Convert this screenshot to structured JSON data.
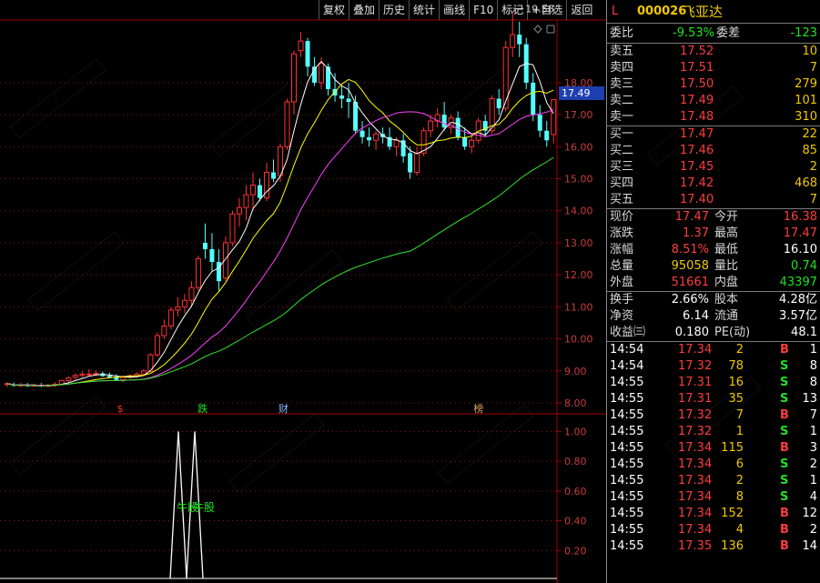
{
  "toolbar": [
    "复权",
    "叠加",
    "历史",
    "统计",
    "画线",
    "F10",
    "标记",
    "+自选",
    "返回"
  ],
  "stock": {
    "flag": "L",
    "code": "000026",
    "name": "飞亚达"
  },
  "commission": {
    "ratio_label": "委比",
    "ratio": "-9.53%",
    "diff_label": "委差",
    "diff": "-123"
  },
  "asks": [
    {
      "label": "卖五",
      "price": "17.52",
      "vol": "10"
    },
    {
      "label": "卖四",
      "price": "17.51",
      "vol": "7"
    },
    {
      "label": "卖三",
      "price": "17.50",
      "vol": "279"
    },
    {
      "label": "卖二",
      "price": "17.49",
      "vol": "101"
    },
    {
      "label": "卖一",
      "price": "17.48",
      "vol": "310"
    }
  ],
  "bids": [
    {
      "label": "买一",
      "price": "17.47",
      "vol": "22"
    },
    {
      "label": "买二",
      "price": "17.46",
      "vol": "85"
    },
    {
      "label": "买三",
      "price": "17.45",
      "vol": "2"
    },
    {
      "label": "买四",
      "price": "17.42",
      "vol": "468"
    },
    {
      "label": "买五",
      "price": "17.40",
      "vol": "7"
    }
  ],
  "stats1": [
    {
      "l1": "现价",
      "v1": "17.47",
      "c1": "red",
      "l2": "今开",
      "v2": "16.38",
      "c2": "red"
    },
    {
      "l1": "涨跌",
      "v1": "1.37",
      "c1": "red",
      "l2": "最高",
      "v2": "17.47",
      "c2": "red"
    },
    {
      "l1": "涨幅",
      "v1": "8.51%",
      "c1": "red",
      "l2": "最低",
      "v2": "16.10",
      "c2": "white"
    },
    {
      "l1": "总量",
      "v1": "95058",
      "c1": "yellow",
      "l2": "量比",
      "v2": "0.74",
      "c2": "green"
    },
    {
      "l1": "外盘",
      "v1": "51661",
      "c1": "red",
      "l2": "内盘",
      "v2": "43397",
      "c2": "green"
    }
  ],
  "stats2": [
    {
      "l1": "换手",
      "v1": "2.66%",
      "l2": "股本",
      "v2": "4.28亿"
    },
    {
      "l1": "净资",
      "v1": "6.14",
      "l2": "流通",
      "v2": "3.57亿"
    },
    {
      "l1": "收益㈢",
      "v1": "0.180",
      "l2": "PE(动)",
      "v2": "48.1"
    }
  ],
  "trades": [
    {
      "time": "14:54",
      "price": "17.34",
      "vol": "2",
      "side": "B",
      "n": "1"
    },
    {
      "time": "14:54",
      "price": "17.32",
      "vol": "78",
      "side": "S",
      "n": "8"
    },
    {
      "time": "14:55",
      "price": "17.31",
      "vol": "16",
      "side": "S",
      "n": "8"
    },
    {
      "time": "14:55",
      "price": "17.31",
      "vol": "35",
      "side": "S",
      "n": "13"
    },
    {
      "time": "14:55",
      "price": "17.32",
      "vol": "7",
      "side": "B",
      "n": "7"
    },
    {
      "time": "14:55",
      "price": "17.32",
      "vol": "1",
      "side": "S",
      "n": "1"
    },
    {
      "time": "14:55",
      "price": "17.34",
      "vol": "115",
      "side": "B",
      "n": "3"
    },
    {
      "time": "14:55",
      "price": "17.34",
      "vol": "6",
      "side": "S",
      "n": "2"
    },
    {
      "time": "14:55",
      "price": "17.34",
      "vol": "2",
      "side": "S",
      "n": "1"
    },
    {
      "time": "14:55",
      "price": "17.34",
      "vol": "8",
      "side": "S",
      "n": "4"
    },
    {
      "time": "14:55",
      "price": "17.34",
      "vol": "152",
      "side": "B",
      "n": "12"
    },
    {
      "time": "14:55",
      "price": "17.34",
      "vol": "4",
      "side": "B",
      "n": "2"
    },
    {
      "time": "14:55",
      "price": "17.35",
      "vol": "136",
      "side": "B",
      "n": "14"
    }
  ],
  "chart": {
    "current_price": "17.49",
    "high_label": "19.58",
    "price_axis": [
      "18.00",
      "17.00",
      "16.00",
      "15.00",
      "14.00",
      "13.00",
      "12.00",
      "11.00",
      "10.00",
      "9.00",
      "8.00"
    ],
    "markers": [
      {
        "text": "$",
        "color": "#ff3030"
      },
      {
        "text": "跌",
        "color": "#21e021"
      },
      {
        "text": "财",
        "color": "#8fb8ff"
      },
      {
        "text": "榜",
        "color": "#e0a060"
      }
    ],
    "indicator_axis": [
      "1.00",
      "0.80",
      "0.60",
      "0.40",
      "0.20"
    ],
    "indicator_label": "牛股",
    "indicator_label2": "牛股",
    "colors": {
      "up": "#ff3232",
      "down": "#54ffff",
      "ma5": "#ffffff",
      "ma10": "#ffff00",
      "ma20": "#ff40ff",
      "ma60": "#2ee62e"
    }
  },
  "chart_data": {
    "type": "candlestick",
    "ylim": [
      7.8,
      19.9
    ],
    "candles": [
      {
        "o": 8.58,
        "h": 8.64,
        "l": 8.5,
        "c": 8.6
      },
      {
        "o": 8.58,
        "h": 8.64,
        "l": 8.5,
        "c": 8.54
      },
      {
        "o": 8.55,
        "h": 8.62,
        "l": 8.5,
        "c": 8.56
      },
      {
        "o": 8.55,
        "h": 8.62,
        "l": 8.5,
        "c": 8.53
      },
      {
        "o": 8.54,
        "h": 8.6,
        "l": 8.5,
        "c": 8.55
      },
      {
        "o": 8.55,
        "h": 8.62,
        "l": 8.5,
        "c": 8.52
      },
      {
        "o": 8.53,
        "h": 8.6,
        "l": 8.48,
        "c": 8.55
      },
      {
        "o": 8.55,
        "h": 8.65,
        "l": 8.5,
        "c": 8.58
      },
      {
        "o": 8.58,
        "h": 8.72,
        "l": 8.55,
        "c": 8.7
      },
      {
        "o": 8.7,
        "h": 8.82,
        "l": 8.65,
        "c": 8.78
      },
      {
        "o": 8.8,
        "h": 8.92,
        "l": 8.72,
        "c": 8.86
      },
      {
        "o": 8.86,
        "h": 8.98,
        "l": 8.8,
        "c": 8.9
      },
      {
        "o": 8.88,
        "h": 9.05,
        "l": 8.82,
        "c": 8.9
      },
      {
        "o": 8.9,
        "h": 9.02,
        "l": 8.85,
        "c": 8.92
      },
      {
        "o": 8.92,
        "h": 8.98,
        "l": 8.8,
        "c": 8.84
      },
      {
        "o": 8.85,
        "h": 8.95,
        "l": 8.78,
        "c": 8.8
      },
      {
        "o": 8.8,
        "h": 8.9,
        "l": 8.7,
        "c": 8.72
      },
      {
        "o": 8.72,
        "h": 8.85,
        "l": 8.65,
        "c": 8.8
      },
      {
        "o": 8.8,
        "h": 8.9,
        "l": 8.75,
        "c": 8.85
      },
      {
        "o": 8.85,
        "h": 8.95,
        "l": 8.8,
        "c": 8.9
      },
      {
        "o": 8.9,
        "h": 9.05,
        "l": 8.85,
        "c": 9.0
      },
      {
        "o": 8.98,
        "h": 9.55,
        "l": 8.95,
        "c": 9.5
      },
      {
        "o": 9.5,
        "h": 10.2,
        "l": 9.45,
        "c": 10.1
      },
      {
        "o": 10.1,
        "h": 10.6,
        "l": 10.0,
        "c": 10.4
      },
      {
        "o": 10.4,
        "h": 11.0,
        "l": 10.3,
        "c": 10.9
      },
      {
        "o": 10.9,
        "h": 11.3,
        "l": 10.7,
        "c": 11.0
      },
      {
        "o": 11.0,
        "h": 11.4,
        "l": 10.8,
        "c": 11.2
      },
      {
        "o": 11.2,
        "h": 11.8,
        "l": 11.0,
        "c": 11.6
      },
      {
        "o": 11.6,
        "h": 12.6,
        "l": 11.5,
        "c": 12.5
      },
      {
        "o": 13.0,
        "h": 13.6,
        "l": 12.5,
        "c": 12.8
      },
      {
        "o": 12.8,
        "h": 13.3,
        "l": 12.1,
        "c": 12.4
      },
      {
        "o": 12.4,
        "h": 12.8,
        "l": 11.5,
        "c": 11.8
      },
      {
        "o": 11.9,
        "h": 13.2,
        "l": 11.8,
        "c": 13.0
      },
      {
        "o": 13.0,
        "h": 14.0,
        "l": 12.9,
        "c": 13.9
      },
      {
        "o": 13.9,
        "h": 14.4,
        "l": 13.5,
        "c": 14.1
      },
      {
        "o": 14.1,
        "h": 14.8,
        "l": 13.7,
        "c": 14.5
      },
      {
        "o": 14.5,
        "h": 15.2,
        "l": 14.0,
        "c": 14.8
      },
      {
        "o": 14.8,
        "h": 15.0,
        "l": 14.3,
        "c": 14.4
      },
      {
        "o": 14.4,
        "h": 15.5,
        "l": 14.3,
        "c": 15.2
      },
      {
        "o": 15.2,
        "h": 15.6,
        "l": 14.9,
        "c": 15.0
      },
      {
        "o": 15.1,
        "h": 16.1,
        "l": 14.9,
        "c": 16.0
      },
      {
        "o": 16.0,
        "h": 17.5,
        "l": 15.9,
        "c": 17.4
      },
      {
        "o": 17.4,
        "h": 19.0,
        "l": 17.0,
        "c": 18.9
      },
      {
        "o": 19.0,
        "h": 19.58,
        "l": 18.8,
        "c": 19.3
      },
      {
        "o": 19.3,
        "h": 19.4,
        "l": 18.2,
        "c": 18.5
      },
      {
        "o": 18.5,
        "h": 18.8,
        "l": 17.9,
        "c": 18.0
      },
      {
        "o": 18.0,
        "h": 18.8,
        "l": 17.8,
        "c": 18.6
      },
      {
        "o": 18.5,
        "h": 18.6,
        "l": 17.6,
        "c": 17.8
      },
      {
        "o": 17.8,
        "h": 18.3,
        "l": 17.4,
        "c": 17.6
      },
      {
        "o": 17.6,
        "h": 17.9,
        "l": 17.2,
        "c": 17.5
      },
      {
        "o": 17.5,
        "h": 18.0,
        "l": 16.9,
        "c": 17.4
      },
      {
        "o": 17.4,
        "h": 17.6,
        "l": 16.4,
        "c": 16.5
      },
      {
        "o": 16.5,
        "h": 16.8,
        "l": 16.1,
        "c": 16.3
      },
      {
        "o": 16.3,
        "h": 16.6,
        "l": 16.0,
        "c": 16.2
      },
      {
        "o": 16.2,
        "h": 16.5,
        "l": 15.9,
        "c": 16.4
      },
      {
        "o": 16.4,
        "h": 16.6,
        "l": 16.1,
        "c": 16.3
      },
      {
        "o": 16.3,
        "h": 16.6,
        "l": 15.9,
        "c": 16.0
      },
      {
        "o": 16.0,
        "h": 16.3,
        "l": 15.7,
        "c": 16.2
      },
      {
        "o": 16.2,
        "h": 16.4,
        "l": 15.5,
        "c": 15.7
      },
      {
        "o": 15.8,
        "h": 16.0,
        "l": 15.0,
        "c": 15.2
      },
      {
        "o": 15.2,
        "h": 16.0,
        "l": 15.1,
        "c": 15.8
      },
      {
        "o": 15.8,
        "h": 16.6,
        "l": 15.7,
        "c": 16.5
      },
      {
        "o": 16.5,
        "h": 17.0,
        "l": 16.3,
        "c": 16.8
      },
      {
        "o": 16.8,
        "h": 17.2,
        "l": 16.6,
        "c": 17.0
      },
      {
        "o": 17.0,
        "h": 17.4,
        "l": 16.5,
        "c": 16.6
      },
      {
        "o": 16.6,
        "h": 17.0,
        "l": 16.4,
        "c": 16.9
      },
      {
        "o": 16.9,
        "h": 17.1,
        "l": 16.2,
        "c": 16.3
      },
      {
        "o": 16.3,
        "h": 16.6,
        "l": 15.9,
        "c": 16.0
      },
      {
        "o": 16.0,
        "h": 16.4,
        "l": 15.8,
        "c": 16.2
      },
      {
        "o": 16.2,
        "h": 16.9,
        "l": 16.1,
        "c": 16.8
      },
      {
        "o": 16.8,
        "h": 17.0,
        "l": 16.3,
        "c": 16.5
      },
      {
        "o": 16.5,
        "h": 17.6,
        "l": 16.4,
        "c": 17.5
      },
      {
        "o": 17.5,
        "h": 17.8,
        "l": 17.0,
        "c": 17.2
      },
      {
        "o": 17.2,
        "h": 19.3,
        "l": 17.1,
        "c": 19.1
      },
      {
        "o": 19.1,
        "h": 20.2,
        "l": 18.8,
        "c": 19.5
      },
      {
        "o": 19.5,
        "h": 19.9,
        "l": 18.8,
        "c": 19.2
      },
      {
        "o": 19.2,
        "h": 19.4,
        "l": 17.8,
        "c": 18.0
      },
      {
        "o": 18.0,
        "h": 18.3,
        "l": 16.8,
        "c": 17.0
      },
      {
        "o": 17.0,
        "h": 17.3,
        "l": 16.3,
        "c": 16.5
      },
      {
        "o": 16.5,
        "h": 16.8,
        "l": 16.0,
        "c": 16.2
      },
      {
        "o": 16.38,
        "h": 17.47,
        "l": 16.1,
        "c": 17.47
      }
    ],
    "ma_periods": [
      5,
      10,
      20,
      60
    ],
    "indicator": {
      "ylim": [
        0,
        1.1
      ],
      "values": [
        0,
        0,
        0,
        0,
        0,
        0,
        0,
        0,
        0,
        0,
        0,
        0,
        0,
        0,
        0,
        0,
        0,
        0,
        0,
        0,
        0,
        0,
        0,
        0,
        0,
        0,
        0,
        0,
        0,
        0,
        0,
        0,
        0,
        0,
        0,
        0,
        0,
        0,
        0,
        0,
        0,
        0,
        0,
        0,
        0,
        0,
        0,
        0,
        0,
        0,
        0,
        0,
        0,
        0,
        0,
        0,
        0,
        0,
        0,
        0,
        0,
        0,
        0,
        0,
        0,
        0,
        0,
        0,
        0,
        0,
        0,
        0,
        0,
        0,
        0,
        0,
        0,
        0,
        0,
        0,
        0
      ]
    }
  }
}
